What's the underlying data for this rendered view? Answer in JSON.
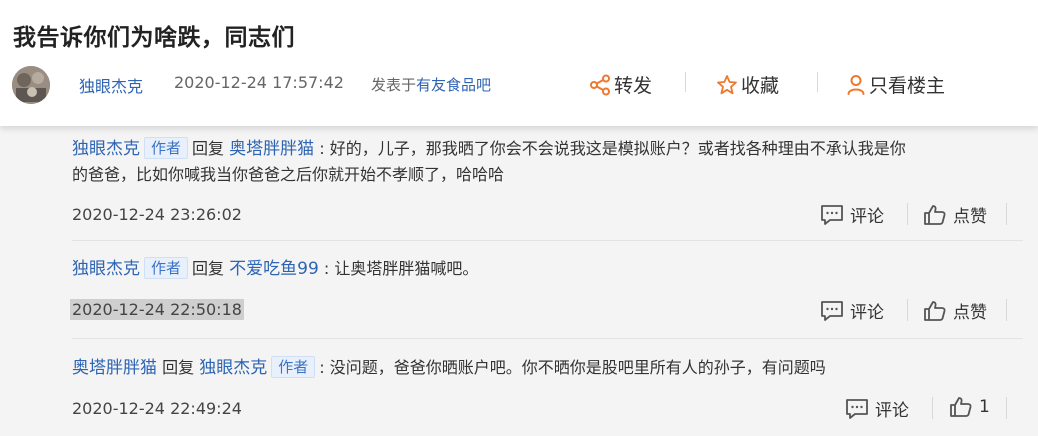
{
  "post": {
    "title": "我告诉你们为啥跌，同志们",
    "author": "独眼杰克",
    "time": "2020-12-24 17:57:42",
    "posted_in_prefix": "发表于",
    "board": "有友食品吧"
  },
  "actions": {
    "share": "转发",
    "favorite": "收藏",
    "only_host": "只看楼主"
  },
  "replies": [
    {
      "author": "独眼杰克",
      "badge": "作者",
      "reply_word": "回复",
      "target": "奥塔胖胖猫",
      "target_badge": "",
      "text_line1": ": 好的，儿子，那我晒了你会不会说我这是模拟账户？或者找各种理由不承认我是你",
      "text_line2": "的爸爸，比如你喊我当你爸爸之后你就开始不孝顺了，哈哈哈",
      "time": "2020-12-24 23:26:02",
      "comment_label": "评论",
      "like_label": "点赞"
    },
    {
      "author": "独眼杰克",
      "badge": "作者",
      "reply_word": "回复",
      "target": "不爱吃鱼99",
      "target_badge": "",
      "text_line1": ": 让奥塔胖胖猫喊吧。",
      "time": "2020-12-24 22:50:18",
      "comment_label": "评论",
      "like_label": "点赞"
    },
    {
      "author": "奥塔胖胖猫",
      "badge": "",
      "reply_word": "回复",
      "target": "独眼杰克",
      "target_badge": "作者",
      "text_line1": ": 没问题，爸爸你晒账户吧。你不晒你是股吧里所有人的孙子，有问题吗",
      "time": "2020-12-24 22:49:24",
      "comment_label": "评论",
      "like_label": "1"
    }
  ],
  "icons": {
    "share": "share-icon",
    "favorite": "star-icon",
    "host": "person-icon",
    "comment": "comment-icon",
    "like": "thumbs-up-icon"
  },
  "colors": {
    "accent_orange": "#f0782d",
    "link_blue": "#2d64b3"
  }
}
